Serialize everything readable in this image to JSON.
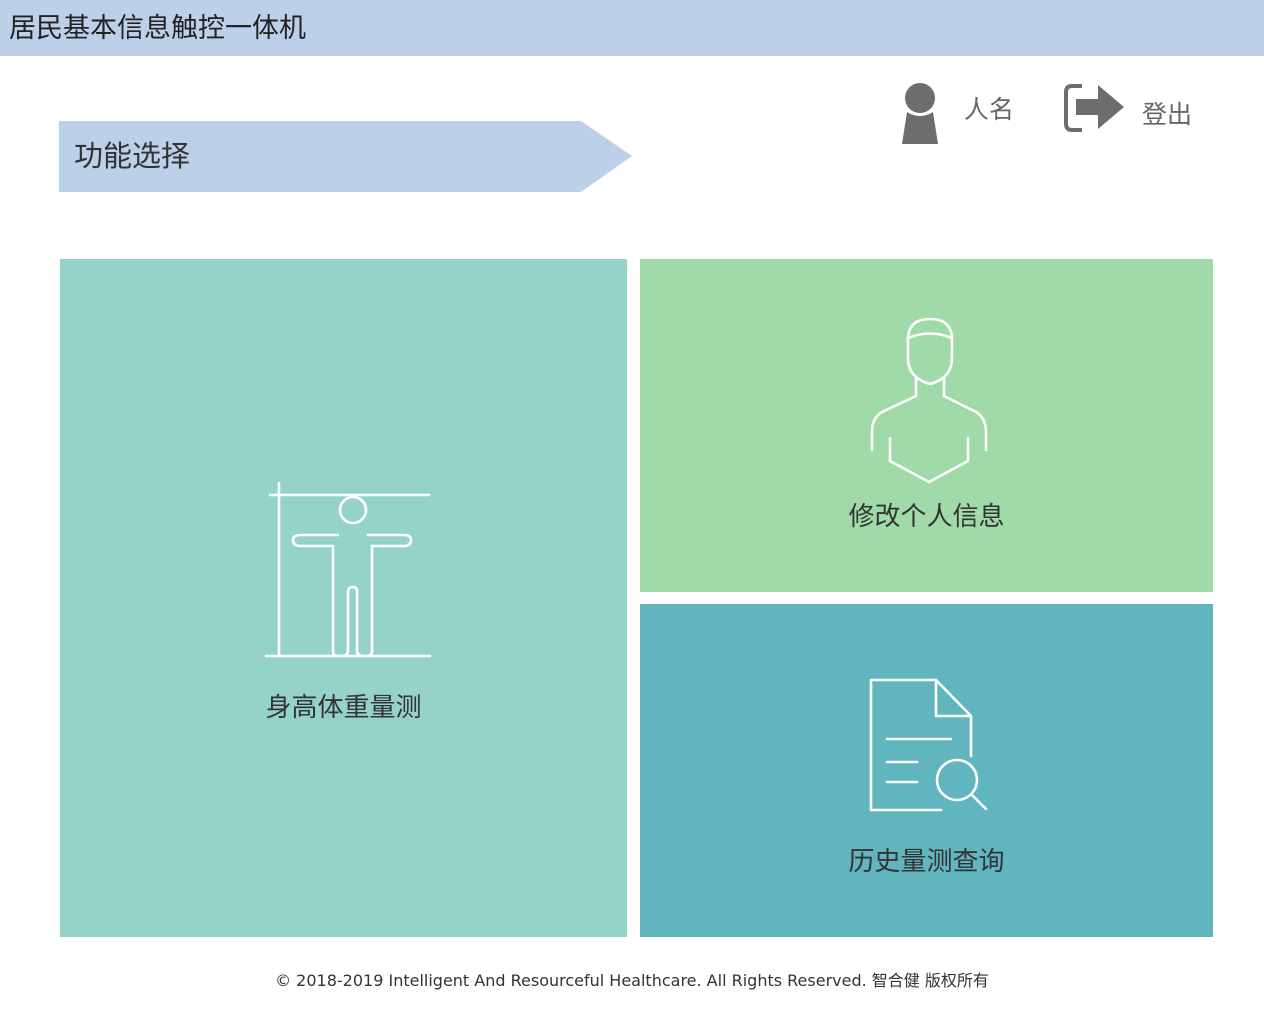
{
  "header": {
    "title": "居民基本信息触控一体机"
  },
  "user": {
    "name": "人名",
    "icon": "user-silhouette-icon"
  },
  "logout": {
    "label": "登出",
    "icon": "logout-icon"
  },
  "section": {
    "title": "功能选择"
  },
  "tiles": [
    {
      "label": "身高体重量测",
      "icon": "body-measure-icon",
      "color": "#95d3ca"
    },
    {
      "label": "修改个人信息",
      "icon": "person-profile-icon",
      "color": "#9fdaa8"
    },
    {
      "label": "历史量测查询",
      "icon": "document-search-icon",
      "color": "#61b5bf"
    }
  ],
  "footer": {
    "text": "© 2018-2019 Intelligent And Resourceful Healthcare. All Rights Reserved. 智合健 版权所有"
  },
  "colors": {
    "header_bg": "#bcd1e9",
    "banner_bg": "#bcd1e9",
    "icon_gray": "#6d6d6d"
  }
}
